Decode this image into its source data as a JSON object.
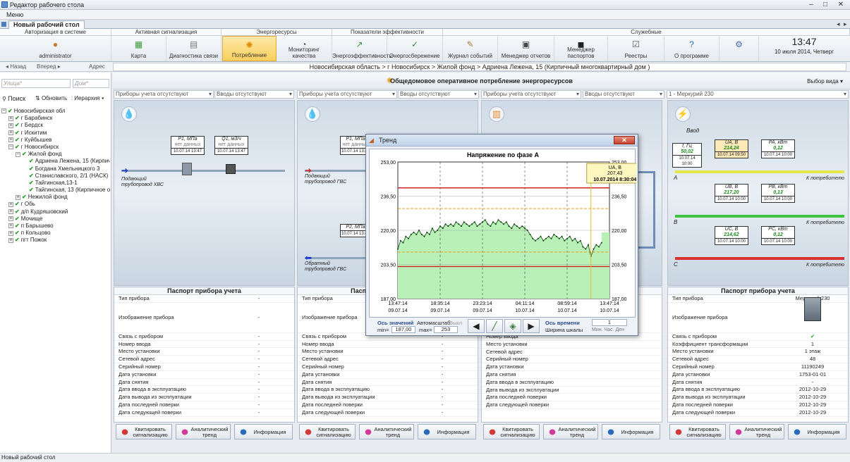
{
  "window": {
    "title": "Редактор рабочего стола",
    "menu": "Меню",
    "tab": "Новый рабочий стол",
    "status": "Новый рабочий стол"
  },
  "ribbon": {
    "groups": [
      "Авторизация в системе",
      "Активная сигнализация",
      "Энергоресурсы",
      "Показатели эффективности",
      "Служебные"
    ],
    "buttons": {
      "user": "administrator",
      "map": "Карта",
      "diag": "Диагностика связи",
      "consumption": "Потребление",
      "quality": "Мониторинг качества",
      "efficiency": "Энергоэффективность",
      "saving": "Энергосбережение",
      "journal": "Журнал событий",
      "reports": "Менеджер отчетов",
      "passports": "Менеджер паспортов",
      "registers": "Реестры",
      "about": "О программе"
    },
    "time": "13:47",
    "date": "10 июля 2014, Четверг"
  },
  "nav": {
    "back": "Назад",
    "forward": "Вперед",
    "address_label": "Адрес",
    "address": "Новосибирская область > г Новосибирск > Жилой фонд > Адриена Лежена, 15 (Кирпичный многоквартирный дом )"
  },
  "left": {
    "street_placeholder": "Улица*",
    "house_placeholder": "Дом*",
    "search": "Поиск",
    "refresh": "Обновить",
    "hierarchy": "Иерархия",
    "tree": [
      {
        "label": "Новосибирская обл",
        "level": 0,
        "exp": "−"
      },
      {
        "label": "г Барабинск",
        "level": 1,
        "exp": "+"
      },
      {
        "label": "г Бердск",
        "level": 1,
        "exp": "+"
      },
      {
        "label": "г Искитим",
        "level": 1,
        "exp": "+"
      },
      {
        "label": "г Куйбышев",
        "level": 1,
        "exp": "+"
      },
      {
        "label": "г Новосибирск",
        "level": 1,
        "exp": "−"
      },
      {
        "label": "Жилой фонд",
        "level": 2,
        "exp": "−"
      },
      {
        "label": "Адриена Лежена, 15 (Кирпичный",
        "level": 3,
        "exp": ""
      },
      {
        "label": "Богдана Хмельницкого 3",
        "level": 3,
        "exp": ""
      },
      {
        "label": "Станиславского, 2/1 (НАСК)",
        "level": 3,
        "exp": ""
      },
      {
        "label": "Тайгинская,13-1",
        "level": 3,
        "exp": ""
      },
      {
        "label": "Тайгинская, 13 (Кирпичное о",
        "level": 3,
        "exp": ""
      },
      {
        "label": "Нежилой фонд",
        "level": 2,
        "exp": "+"
      },
      {
        "label": "г Обь",
        "level": 1,
        "exp": "+"
      },
      {
        "label": "д/п Кудряшовский",
        "level": 1,
        "exp": "+"
      },
      {
        "label": "Мочище",
        "level": 1,
        "exp": "+"
      },
      {
        "label": "п Барышево",
        "level": 1,
        "exp": "+"
      },
      {
        "label": "п Кольцово",
        "level": 1,
        "exp": "+"
      },
      {
        "label": "пгт Пожок",
        "level": 1,
        "exp": "+"
      }
    ]
  },
  "view": {
    "title": "Общедомовое оперативное потребление энергоресурсов",
    "select": "Выбор вида"
  },
  "dropdowns": [
    "Приборы учета отсутствуют",
    "Вводы отсутствуют",
    "Приборы учета отсутствуют",
    "Вводы отсутствуют",
    "Приборы учета отсутствуют",
    "Вводы отсутствуют",
    "1 - Меркурий 230"
  ],
  "panels": {
    "p1": {
      "boxes": [
        {
          "h": "P1, МПа",
          "v": "нет данных",
          "ts": "10.07.14 13:47"
        },
        {
          "h": "Q1, м3/ч",
          "v": "нет данных",
          "ts": "10.07.14 13:47"
        }
      ],
      "label": "Подающий трубопровод ХВС"
    },
    "p2": {
      "boxes": [
        {
          "h": "P1, МПа",
          "v": "нет данных",
          "ts": "10.07.14 13:47"
        },
        {
          "h": "P2, МПа",
          "v": "",
          "ts": "10.07.14 13:47"
        }
      ],
      "label_top": "Подающий трубопровод ГВС",
      "label_bottom": "Обратный трубопровод ГВС"
    },
    "p4": {
      "input": "Ввод",
      "freq": {
        "h": "f, Гц",
        "v": "50,02",
        "ts": "10.07.14 10:00"
      },
      "phases": [
        {
          "phase": "A",
          "u": {
            "h": "UA, В",
            "v": "214,24",
            "ts": "10.07.14 09:50"
          },
          "p": {
            "h": "PA, кВт",
            "v": "0,12",
            "ts": "10.07.14 10:00"
          }
        },
        {
          "phase": "B",
          "u": {
            "h": "UB, В",
            "v": "217,20",
            "ts": "10.07.14 10:00"
          },
          "p": {
            "h": "PB, кВт",
            "v": "0,13",
            "ts": "10.07.14 10:00"
          }
        },
        {
          "phase": "C",
          "u": {
            "h": "UC, В",
            "v": "214,62",
            "ts": "10.07.14 10:00"
          },
          "p": {
            "h": "PC, кВт",
            "v": "0,12",
            "ts": "10.07.14 10:00"
          }
        }
      ],
      "to_consumer": "К потребителю"
    }
  },
  "passport": {
    "title": "Паспорт прибора учета",
    "rows": [
      "Тип прибора",
      "Изображение прибора",
      "Связь с прибором",
      "Номер ввода",
      "Место установки",
      "Сетевой адрес",
      "Серийный номер",
      "Дата установки",
      "Дата снятия",
      "Дата ввода в эксплуатацию",
      "Дата вывода из эксплуатации",
      "Дата последней поверки",
      "Дата следующей поверки"
    ],
    "rows_p3": [
      "Связь с прибором",
      "Номер ввода",
      "Место установки",
      "Сетевой адрес",
      "Серийный номер",
      "Дата установки",
      "Дата снятия",
      "Дата ввода в эксплуатацию",
      "Дата вывода из эксплуатации",
      "Дата последней поверки",
      "Дата следующей поверки"
    ],
    "empty": "-",
    "p4_rows": [
      "Тип прибора",
      "Изображение прибора",
      "Связь с прибором",
      "Коэффициент трансформации",
      "Место установки",
      "Сетевой адрес",
      "Серийный номер",
      "Дата установки",
      "Дата снятия",
      "Дата ввода в эксплуатацию",
      "Дата вывода из эксплуатации",
      "Дата последней поверки",
      "Дата следующей поверки"
    ],
    "p4_vals": [
      "Меркурий 230",
      "",
      "✔",
      "1",
      "1 этаж",
      "48",
      "11190249",
      "1753-01-01",
      "-",
      "2012-10-29",
      "2012-10-29",
      "2012-10-29",
      "2012-10-29"
    ]
  },
  "footer": {
    "ack": "Квитировать сигнализацию",
    "trend": "Аналитический тренд",
    "info": "Информация"
  },
  "trend": {
    "window_title": "Тренд",
    "ctrl": {
      "axis_values": "Ось значений",
      "autoscale": "Автомасштаб",
      "off": "Выкл",
      "min_label": "min=",
      "min": "187,00",
      "max_label": "max=",
      "max": "253",
      "axis_time": "Ось времени",
      "scale_width": "Ширина шкалы",
      "width": "1",
      "units": "Мин. Час. Ден"
    }
  },
  "chart_data": {
    "type": "line",
    "title": "Напряжение по фазе А",
    "ylim": [
      187,
      253
    ],
    "yticks": [
      "253,00",
      "236,50",
      "220,00",
      "203,50",
      "187,00"
    ],
    "xticks": [
      [
        "13:47:14",
        "09.07.14"
      ],
      [
        "18:35:14",
        "09.07.14"
      ],
      [
        "23:23:14",
        "09.07.14"
      ],
      [
        "04:11:14",
        "10.07.14"
      ],
      [
        "08:59:14",
        "10.07.14"
      ],
      [
        "13:47:14",
        "10.07.14"
      ]
    ],
    "xlim": [
      0,
      24
    ],
    "limits": {
      "red": [
        240.5,
        202.5
      ],
      "orange": [
        230.5,
        209.5
      ]
    },
    "cursor": {
      "x": 21.9,
      "label": "UA, В",
      "value": "207,43",
      "time": "10.07.2014 8:30:04"
    },
    "series": [
      {
        "values": [
          [
            0.0,
            211
          ],
          [
            0.3,
            215
          ],
          [
            0.6,
            214
          ],
          [
            0.9,
            217
          ],
          [
            1.2,
            216
          ],
          [
            1.5,
            218
          ],
          [
            1.8,
            219
          ],
          [
            2.1,
            218
          ],
          [
            2.4,
            220
          ],
          [
            2.7,
            218
          ],
          [
            3.0,
            217
          ],
          [
            3.3,
            219
          ],
          [
            3.6,
            218
          ],
          [
            3.9,
            221
          ],
          [
            4.2,
            219
          ],
          [
            4.5,
            220
          ],
          [
            4.8,
            222
          ],
          [
            5.1,
            221
          ],
          [
            5.4,
            223
          ],
          [
            5.7,
            222
          ],
          [
            6.0,
            223
          ],
          [
            6.3,
            222
          ],
          [
            6.6,
            224
          ],
          [
            6.9,
            223
          ],
          [
            7.2,
            222
          ],
          [
            7.5,
            224
          ],
          [
            7.8,
            223
          ],
          [
            8.1,
            222
          ],
          [
            8.4,
            223
          ],
          [
            8.7,
            224
          ],
          [
            9.0,
            222
          ],
          [
            9.3,
            223
          ],
          [
            9.6,
            224
          ],
          [
            9.9,
            225
          ],
          [
            10.2,
            223
          ],
          [
            10.5,
            222
          ],
          [
            10.8,
            224
          ],
          [
            11.1,
            223
          ],
          [
            11.4,
            225
          ],
          [
            11.7,
            224
          ],
          [
            12.0,
            223
          ],
          [
            12.3,
            224
          ],
          [
            12.6,
            222
          ],
          [
            12.9,
            221
          ],
          [
            13.2,
            223
          ],
          [
            13.5,
            222
          ],
          [
            13.8,
            221
          ],
          [
            14.1,
            222
          ],
          [
            14.4,
            221
          ],
          [
            14.7,
            220
          ],
          [
            15.0,
            218
          ],
          [
            15.3,
            216
          ],
          [
            15.6,
            215
          ],
          [
            15.9,
            216
          ],
          [
            16.2,
            217
          ],
          [
            16.5,
            215
          ],
          [
            16.8,
            216
          ],
          [
            17.1,
            217
          ],
          [
            17.4,
            216
          ],
          [
            17.7,
            218
          ],
          [
            18.0,
            217
          ],
          [
            18.3,
            216
          ],
          [
            18.6,
            217
          ],
          [
            18.9,
            215
          ],
          [
            19.2,
            216
          ],
          [
            19.5,
            217
          ],
          [
            19.8,
            215
          ],
          [
            20.1,
            216
          ],
          [
            20.4,
            214
          ],
          [
            20.7,
            215
          ],
          [
            21.0,
            212
          ],
          [
            21.3,
            211
          ],
          [
            21.6,
            213
          ],
          [
            21.9,
            207.4
          ],
          [
            22.2,
            211
          ],
          [
            22.5,
            213
          ],
          [
            22.8,
            212
          ],
          [
            23.1,
            214
          ]
        ]
      }
    ]
  },
  "colors": {
    "accent": "#f9cf5d",
    "fill_green": "#b8f0b8",
    "red_limit": "#cc2222",
    "orange_limit": "#e8a020",
    "phase_a": "#e6e645",
    "phase_b": "#3ec43e",
    "phase_c": "#d93030"
  }
}
